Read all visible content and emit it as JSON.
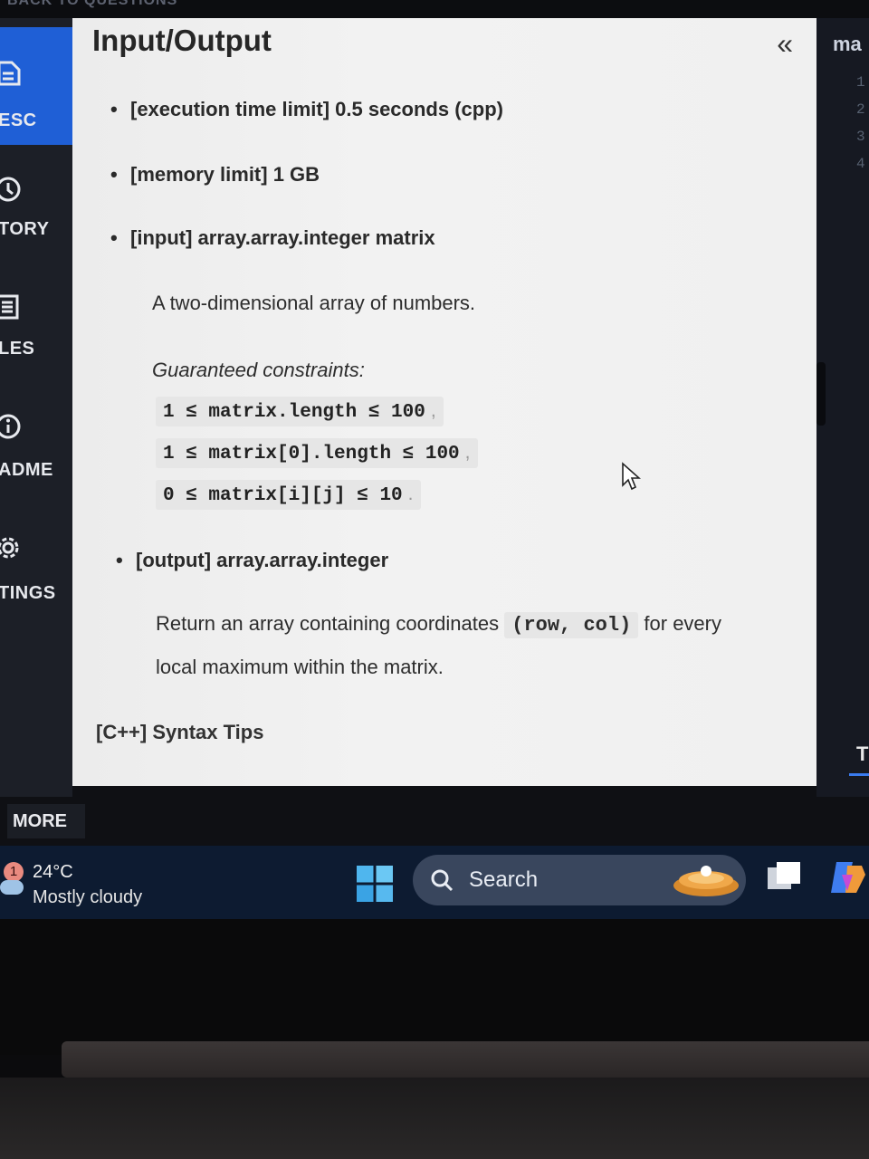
{
  "top_strip": {
    "text": "BACK TO QUESTIONS"
  },
  "sidebar": {
    "items": [
      {
        "label": "ESC",
        "icon": "document-icon",
        "active": true
      },
      {
        "label": "TORY",
        "icon": "clock-icon"
      },
      {
        "label": "LES",
        "icon": "list-icon"
      },
      {
        "label": "ADME",
        "icon": "info-icon"
      },
      {
        "label": "TINGS",
        "icon": "gear-icon"
      }
    ],
    "more_label": "MORE"
  },
  "panel": {
    "title": "Input/Output",
    "collapse_glyph": "«",
    "exec_limit": "[execution time limit] 0.5 seconds (cpp)",
    "memory_limit": "[memory limit] 1 GB",
    "input_label": "[input] array.array.integer matrix",
    "input_desc": "A two-dimensional array of numbers.",
    "constraints_title": "Guaranteed constraints:",
    "constraints": [
      {
        "code": "1 ≤ matrix.length ≤ 100",
        "tail": ","
      },
      {
        "code": "1 ≤ matrix[0].length ≤ 100",
        "tail": ","
      },
      {
        "code": "0 ≤ matrix[i][j] ≤ 10",
        "tail": "."
      }
    ],
    "output_label": "[output] array.array.integer",
    "output_desc_pre": "Return an array containing coordinates",
    "output_desc_code": "(row, col)",
    "output_desc_post": "for every",
    "output_desc_line2": "local maximum within the matrix.",
    "syntax_tips": "[C++] Syntax Tips"
  },
  "editor": {
    "file_name": "ma",
    "line_numbers": [
      "1",
      "2",
      "3",
      "4"
    ],
    "tab_label": "T"
  },
  "taskbar": {
    "weather_badge": "1",
    "temperature": "24°C",
    "condition": "Mostly cloudy",
    "search_label": "Search"
  },
  "colors": {
    "sidebar_bg": "#1c1f27",
    "active_item": "#1f5fd6",
    "panel_bg": "#f0f0f0",
    "taskbar_bg": "#0d1b31"
  }
}
